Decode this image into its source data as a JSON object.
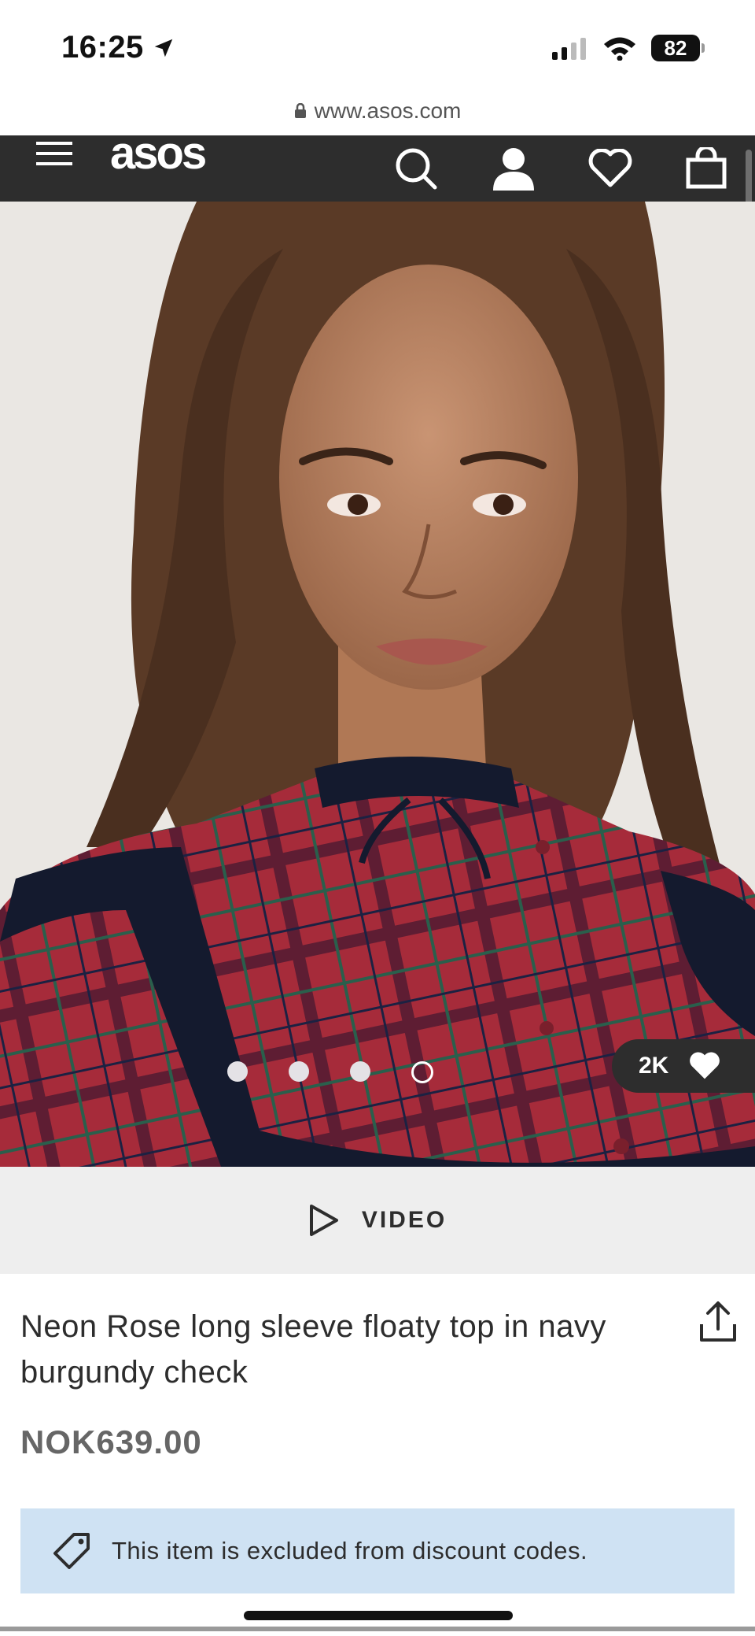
{
  "status_bar": {
    "time": "16:25",
    "battery": "82"
  },
  "browser": {
    "url": "www.asos.com"
  },
  "nav": {
    "logo": "asos"
  },
  "gallery": {
    "image_count": 4,
    "active_index": 3,
    "saves_count": "2K"
  },
  "video": {
    "label": "VIDEO"
  },
  "product": {
    "title": "Neon Rose long sleeve floaty top in navy burgundy check",
    "price": "NOK639.00",
    "discount_notice": "This item is excluded from discount codes."
  },
  "colors": {
    "nav_bg": "#2d2d2d",
    "notice_bg": "#cfe2f3",
    "video_bg": "#eeeeee",
    "plaid_red": "#a62b3a",
    "velvet_navy": "#141a2e"
  }
}
